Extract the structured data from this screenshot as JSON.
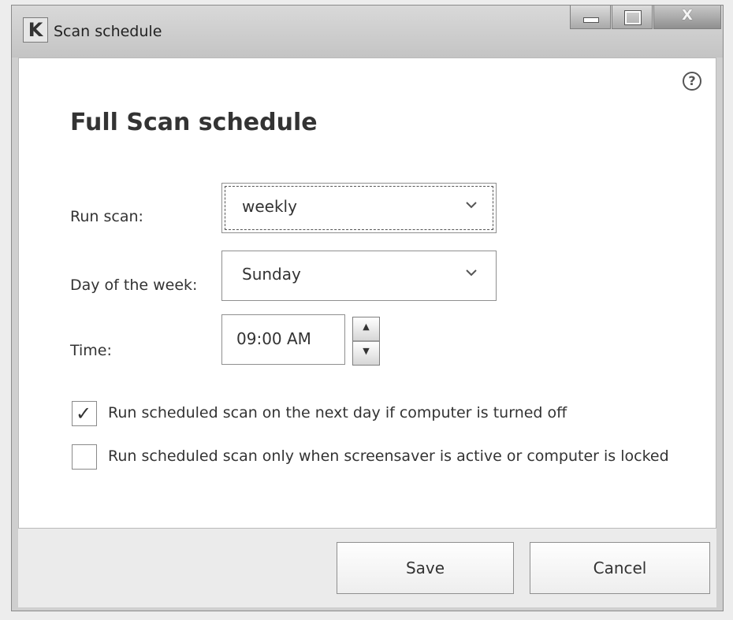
{
  "window": {
    "title": "Scan schedule",
    "controls": {
      "minimize_icon": "minimize-icon",
      "maximize_icon": "maximize-icon",
      "close_label": "X"
    }
  },
  "dialog": {
    "help_label": "?",
    "heading": "Full Scan schedule",
    "fields": {
      "run_scan": {
        "label": "Run scan:",
        "value": "weekly"
      },
      "day_of_week": {
        "label": "Day of the week:",
        "value": "Sunday"
      },
      "time": {
        "label": "Time:",
        "value": "09:00 AM"
      }
    },
    "options": [
      {
        "label": "Run scheduled scan on the next day if computer is turned off",
        "checked": true
      },
      {
        "label": "Run scheduled scan only when screensaver is active or computer is locked",
        "checked": false
      }
    ]
  },
  "footer": {
    "save_label": "Save",
    "cancel_label": "Cancel"
  },
  "colors": {
    "window_frame": "#cfcfcf",
    "content_bg": "#ffffff",
    "text": "#333333"
  }
}
